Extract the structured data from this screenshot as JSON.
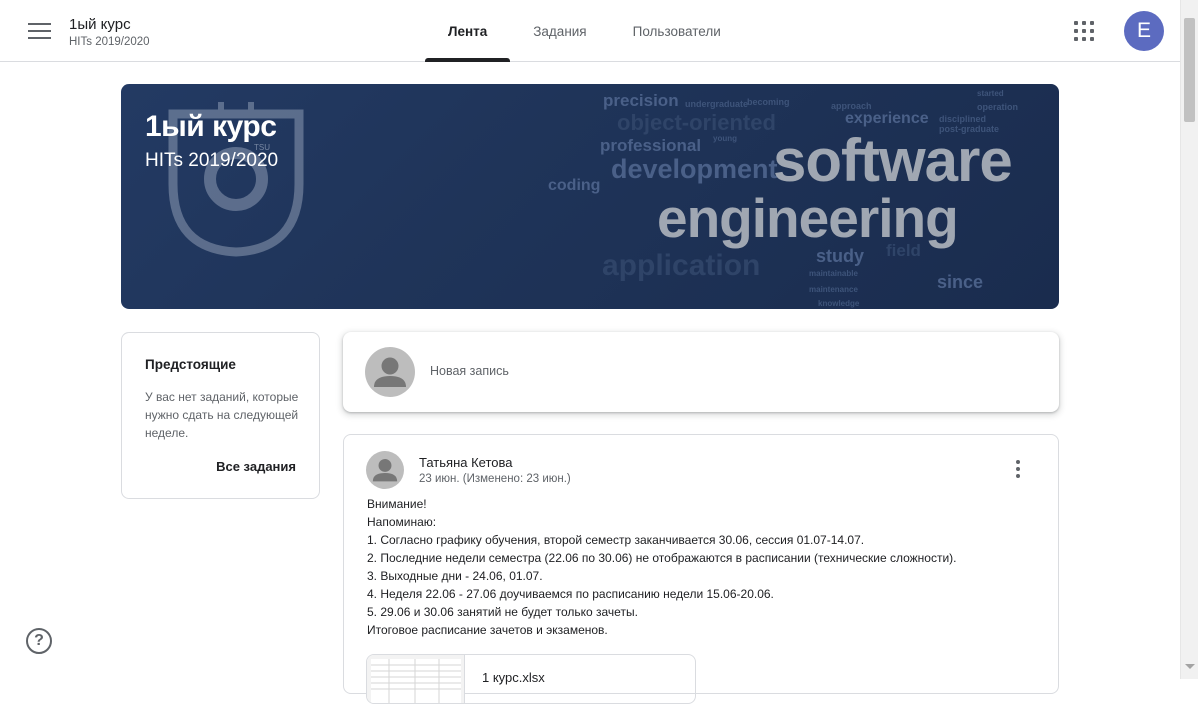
{
  "header": {
    "course_title": "1ый курс",
    "course_sub": "HITs 2019/2020",
    "tabs": [
      {
        "label": "Лента",
        "active": true
      },
      {
        "label": "Задания",
        "active": false
      },
      {
        "label": "Пользователи",
        "active": false
      }
    ],
    "avatar_letter": "E",
    "avatar_color": "#5c6bc0"
  },
  "banner": {
    "title": "1ый курс",
    "subtitle": "HITs 2019/2020",
    "logo_text": "TSU",
    "words": {
      "precision": "precision",
      "undergraduate": "undergraduate",
      "becoming": "becoming",
      "approach": "approach",
      "started": "started",
      "operation": "operation",
      "object_oriented": "object-oriented",
      "experience": "experience",
      "disciplined": "disciplined",
      "post_graduate": "post-graduate",
      "professional": "professional",
      "young": "young",
      "development": "development",
      "software": "software",
      "coding": "coding",
      "engineering": "engineering",
      "application": "application",
      "study": "study",
      "field": "field",
      "maintainable": "maintainable",
      "since": "since",
      "maintenance": "maintenance",
      "knowledge": "knowledge"
    }
  },
  "upcoming": {
    "title": "Предстоящие",
    "text": "У вас нет заданий, которые нужно сдать на следующей неделе.",
    "link": "Все задания"
  },
  "composer": {
    "placeholder": "Новая запись"
  },
  "post": {
    "author": "Татьяна Кетова",
    "date": "23 июн. (Изменено: 23 июн.)",
    "lines": [
      "Внимание!",
      "Напоминаю:",
      "1. Согласно графику обучения, второй семестр заканчивается 30.06, сессия 01.07-14.07.",
      "2. Последние недели семестра (22.06 по 30.06) не отображаются в расписании (технические сложности).",
      "3. Выходные дни - 24.06, 01.07.",
      "4. Неделя 22.06 - 27.06 доучиваемся по расписанию недели 15.06-20.06.",
      "5. 29.06 и 30.06 занятий не будет только зачеты.",
      "Итоговое расписание зачетов и экзаменов."
    ],
    "attachment_name": "1 курс.xlsx"
  },
  "icons": {
    "menu": "menu-icon",
    "apps": "apps-grid-icon",
    "more": "more-vert-icon",
    "help": "help-icon"
  }
}
